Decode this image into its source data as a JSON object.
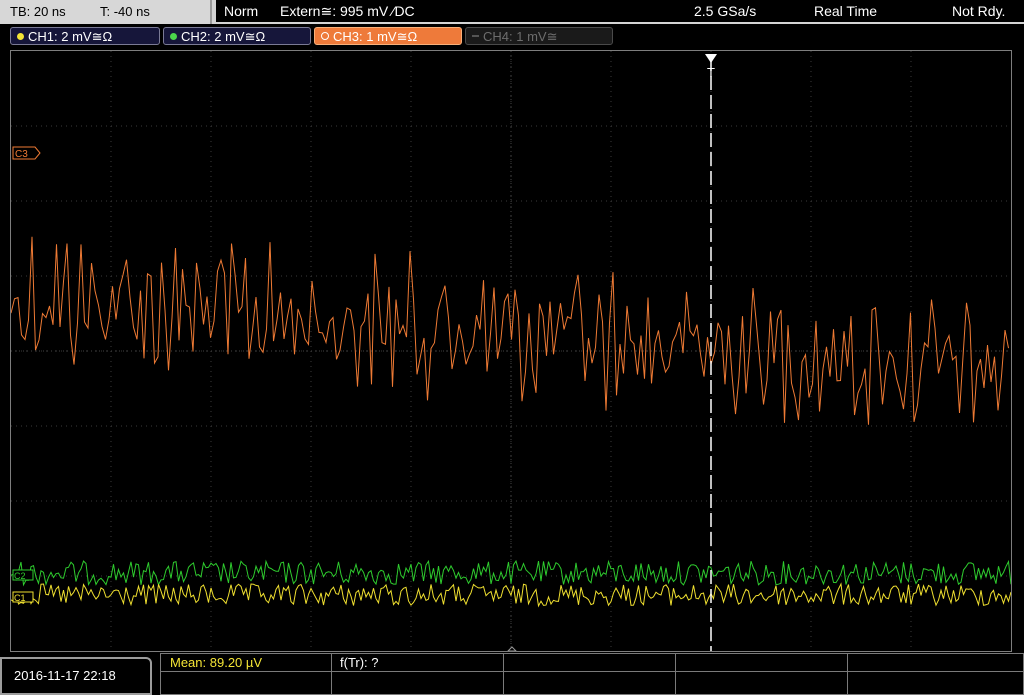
{
  "header": {
    "timebase": "TB: 20 ns",
    "trigger_time": "T: -40 ns",
    "mode": "Norm",
    "trigger_source": "Extern≅: 995 mV ⁄DC",
    "sample_rate": "2.5 GSa/s",
    "acq_mode": "Real Time",
    "status": "Not Rdy."
  },
  "channels": [
    {
      "label": "CH1: 2 mV≅Ω",
      "color": "#f4e536",
      "active": false,
      "enabled": true
    },
    {
      "label": "CH2: 2 mV≅Ω",
      "color": "#4bd64b",
      "active": false,
      "enabled": true
    },
    {
      "label": "CH3: 1 mV≅Ω",
      "color": "#f08040",
      "active": true,
      "enabled": true
    },
    {
      "label": "CH4: 1 mV≅",
      "color": "#777777",
      "active": false,
      "enabled": false
    }
  ],
  "markers": {
    "ch3": "C3",
    "ch2": "C2",
    "ch1": "C1",
    "trigger": "T"
  },
  "waveform_colors": {
    "ch1": "#f0e030",
    "ch2": "#2ecc2e",
    "ch3": "#ee7a34",
    "grid": "#3a3a3a",
    "trigger_line": "#ffffff"
  },
  "footer": {
    "datetime": "2016-11-17 22:18",
    "mean": "Mean: 89.20 µV",
    "freq": "f(Tr): ?"
  }
}
